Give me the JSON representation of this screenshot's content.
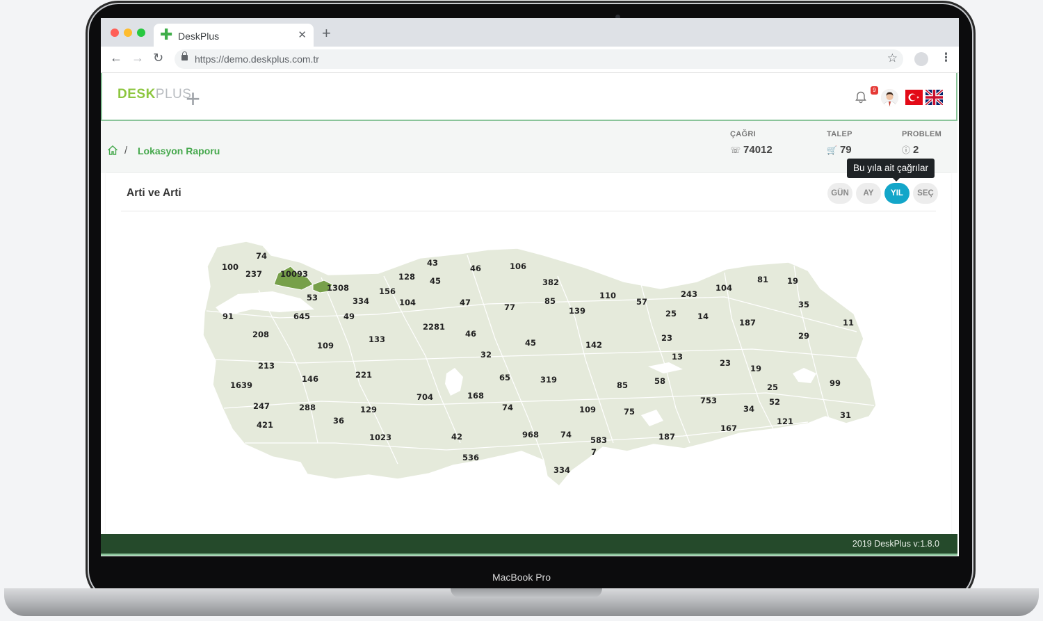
{
  "device": {
    "model_label": "MacBook Pro"
  },
  "browser": {
    "tab_title": "DeskPlus",
    "url": "https://demo.deskplus.com.tr"
  },
  "app": {
    "logo": {
      "desk": "DESK",
      "plus": "PLUS"
    },
    "notification_count": "9",
    "breadcrumb": {
      "current": "Lokasyon Raporu"
    },
    "stats": [
      {
        "label": "ÇAĞRI",
        "value": "74012",
        "icon": "phone-icon"
      },
      {
        "label": "TALEP",
        "value": "79",
        "icon": "cart-icon"
      },
      {
        "label": "PROBLEM",
        "value": "2",
        "icon": "question-icon"
      }
    ],
    "card": {
      "title": "Arti ve Arti",
      "tooltip": "Bu yıla ait çağrılar",
      "periods": [
        "GÜN",
        "AY",
        "YIL",
        "SEÇ"
      ],
      "active_period": "YIL"
    },
    "footer": "2019 DeskPlus v:1.8.0"
  },
  "map": {
    "fill_color": "#e5eadb",
    "highlight_color": "#77a04a",
    "province_counts": [
      "74",
      "100",
      "237",
      "10093",
      "1308",
      "53",
      "43",
      "46",
      "106",
      "128",
      "45",
      "382",
      "156",
      "334",
      "104",
      "47",
      "77",
      "85",
      "110",
      "139",
      "57",
      "243",
      "104",
      "81",
      "19",
      "35",
      "25",
      "14",
      "91",
      "645",
      "49",
      "2281",
      "46",
      "187",
      "11",
      "208",
      "133",
      "45",
      "142",
      "23",
      "29",
      "109",
      "32",
      "13",
      "23",
      "19",
      "213",
      "221",
      "65",
      "319",
      "58",
      "146",
      "85",
      "25",
      "99",
      "1639",
      "704",
      "168",
      "753",
      "52",
      "247",
      "288",
      "74",
      "34",
      "129",
      "109",
      "75",
      "36",
      "121",
      "31",
      "421",
      "1023",
      "42",
      "968",
      "74",
      "583",
      "187",
      "167",
      "7",
      "536",
      "334"
    ]
  },
  "colors": {
    "brand_green": "#45a84c",
    "accent": "#13a6c9",
    "footer_bg": "#254a2b"
  }
}
